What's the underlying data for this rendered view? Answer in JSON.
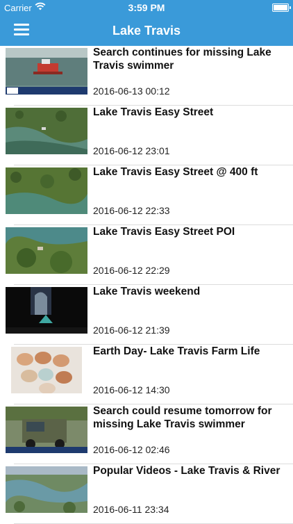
{
  "status": {
    "carrier": "Carrier",
    "time": "3:59 PM"
  },
  "nav": {
    "title": "Lake Travis"
  },
  "items": [
    {
      "title": "Search continues for missing Lake Travis swimmer",
      "date": "2016-06-13 00:12"
    },
    {
      "title": "Lake Travis   Easy Street",
      "date": "2016-06-12 23:01"
    },
    {
      "title": "Lake Travis   Easy Street @ 400 ft",
      "date": "2016-06-12 22:33"
    },
    {
      "title": "Lake Travis   Easy Street POI",
      "date": "2016-06-12 22:29"
    },
    {
      "title": "Lake Travis weekend",
      "date": "2016-06-12 21:39"
    },
    {
      "title": "Earth Day- Lake Travis Farm Life",
      "date": "2016-06-12 14:30"
    },
    {
      "title": "Search could resume tomorrow for missing Lake Travis swimmer",
      "date": "2016-06-12 02:46"
    },
    {
      "title": "Popular Videos - Lake Travis & River",
      "date": "2016-06-11 23:34"
    }
  ]
}
